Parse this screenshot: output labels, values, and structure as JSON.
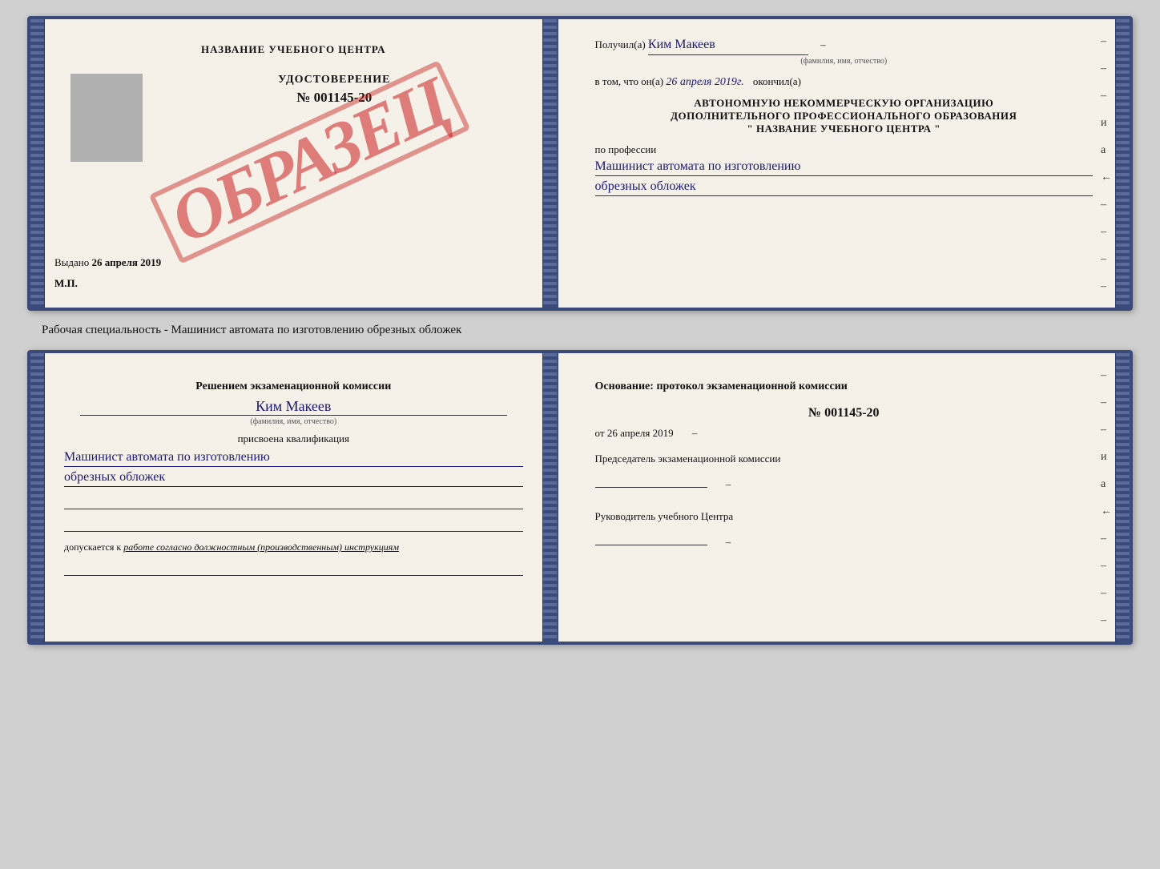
{
  "top_cert": {
    "left": {
      "school_name": "НАЗВАНИЕ УЧЕБНОГО ЦЕНТРА",
      "cert_title": "УДОСТОВЕРЕНИЕ",
      "cert_number": "№ 001145-20",
      "sample_stamp": "ОБРАЗЕЦ",
      "issued_label": "Выдано",
      "issued_date": "26 апреля 2019",
      "mp_label": "М.П."
    },
    "right": {
      "received_label": "Получил(а)",
      "person_name": "Ким Макеев",
      "fio_sublabel": "(фамилия, имя, отчество)",
      "in_that_label": "в том, что он(а)",
      "date_value": "26 апреля 2019г.",
      "finished_label": "окончил(а)",
      "org_line1": "АВТОНОМНУЮ НЕКОММЕРЧЕСКУЮ ОРГАНИЗАЦИЮ",
      "org_line2": "ДОПОЛНИТЕЛЬНОГО ПРОФЕССИОНАЛЬНОГО ОБРАЗОВАНИЯ",
      "org_line3": "\" НАЗВАНИЕ УЧЕБНОГО ЦЕНТРА \"",
      "profession_label": "по профессии",
      "profession_line1": "Машинист автомата по изготовлению",
      "profession_line2": "обрезных обложек",
      "side_dashes": [
        "–",
        "–",
        "–",
        "и",
        "а",
        "←",
        "–",
        "–",
        "–",
        "–"
      ]
    }
  },
  "description": "Рабочая специальность - Машинист автомата по изготовлению обрезных обложек",
  "bottom_cert": {
    "left": {
      "commission_title": "Решением экзаменационной комиссии",
      "person_name": "Ким Макеев",
      "fio_sublabel": "(фамилия, имя, отчество)",
      "qualification_label": "присвоена квалификация",
      "qualification_line1": "Машинист автомата по изготовлению",
      "qualification_line2": "обрезных обложек",
      "allowed_label": "допускается к",
      "allowed_text": "работе согласно должностным (производственным) инструкциям"
    },
    "right": {
      "basis_title": "Основание: протокол экзаменационной комиссии",
      "protocol_number": "№ 001145-20",
      "date_prefix": "от",
      "date_value": "26 апреля 2019",
      "chairman_label": "Председатель экзаменационной комиссии",
      "head_label": "Руководитель учебного Центра",
      "side_dashes": [
        "–",
        "–",
        "–",
        "и",
        "а",
        "←",
        "–",
        "–",
        "–",
        "–"
      ]
    }
  }
}
